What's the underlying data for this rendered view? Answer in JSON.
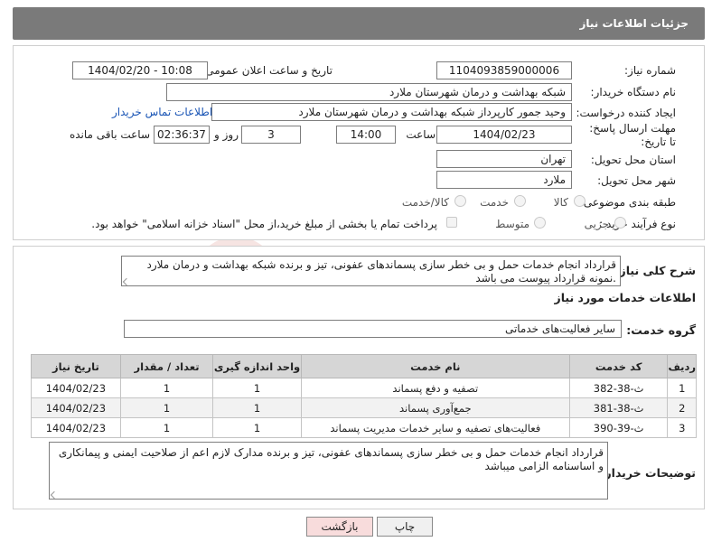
{
  "header": {
    "title": "جزئیات اطلاعات نیاز"
  },
  "need_number": {
    "label": "شماره نیاز:",
    "value": "1104093859000006"
  },
  "announce_datetime": {
    "label": "تاریخ و ساعت اعلان عمومی:",
    "value": "1404/02/20 - 10:08"
  },
  "buyer_org": {
    "label": "نام دستگاه خریدار:",
    "value": "شبکه بهداشت و درمان شهرستان ملارد"
  },
  "requester": {
    "label": "ایجاد کننده درخواست:",
    "value": "وحید جمور کارپرداز شبکه بهداشت و درمان شهرستان ملارد",
    "contact_link": "اطلاعات تماس خریدار"
  },
  "deadline": {
    "label": "مهلت ارسال پاسخ: تا تاریخ:",
    "date": "1404/02/23",
    "time_label": "ساعت",
    "time": "14:00",
    "days": "3",
    "days_label": "روز و",
    "remaining": "02:36:37",
    "remaining_label": "ساعت باقی مانده"
  },
  "province": {
    "label": "استان محل تحویل:",
    "value": "تهران"
  },
  "city": {
    "label": "شهر محل تحویل:",
    "value": "ملارد"
  },
  "category": {
    "label": "طبقه بندی موضوعی:",
    "options": [
      "کالا",
      "خدمت",
      "کالا/خدمت"
    ]
  },
  "purchase_type": {
    "label": "نوع فرآیند خرید :",
    "options": [
      "جزیی",
      "متوسط"
    ],
    "note": "پرداخت تمام یا بخشی از مبلغ خرید،از محل \"اسناد خزانه اسلامی\" خواهد بود."
  },
  "summary": {
    "label": "شرح کلی نیاز:",
    "text": "قرارداد انجام خدمات حمل و بی خطر سازی پسماندهای عفونی، تیز و برنده شبکه بهداشت و درمان ملارد .نمونه قرارداد پیوست می باشد"
  },
  "services_section": {
    "title": "اطلاعات خدمات مورد نیاز"
  },
  "service_group": {
    "label": "گروه خدمت:",
    "value": "سایر فعالیت‌های خدماتی"
  },
  "table": {
    "headers": [
      "ردیف",
      "کد خدمت",
      "نام خدمت",
      "واحد اندازه گیری",
      "تعداد / مقدار",
      "تاریخ نیاز"
    ],
    "rows": [
      [
        "1",
        "ث-38-382",
        "تصفیه و دفع پسماند",
        "1",
        "1",
        "1404/02/23"
      ],
      [
        "2",
        "ث-38-381",
        "جمع‌آوری پسماند",
        "1",
        "1",
        "1404/02/23"
      ],
      [
        "3",
        "ث-39-390",
        "فعالیت‌های تصفیه و سایر خدمات مدیریت پسماند",
        "1",
        "1",
        "1404/02/23"
      ]
    ]
  },
  "buyer_notes": {
    "label": "توضیحات خریدار:",
    "text": "قرارداد انجام خدمات حمل و بی خطر سازی پسماندهای عفونی، تیز و برنده مدارک لازم اعم از صلاحیت ایمنی و پیمانکاری و اساسنامه الزامی میباشد"
  },
  "buttons": {
    "print": "چاپ",
    "back": "بازگشت"
  },
  "watermark": {
    "text": "AriaTender.neT"
  },
  "colors": {
    "header_bg": "#7a7a7a",
    "link": "#1a55b5",
    "back_button_bg": "#f8dcdc",
    "table_header_bg": "#d6d6d6"
  }
}
